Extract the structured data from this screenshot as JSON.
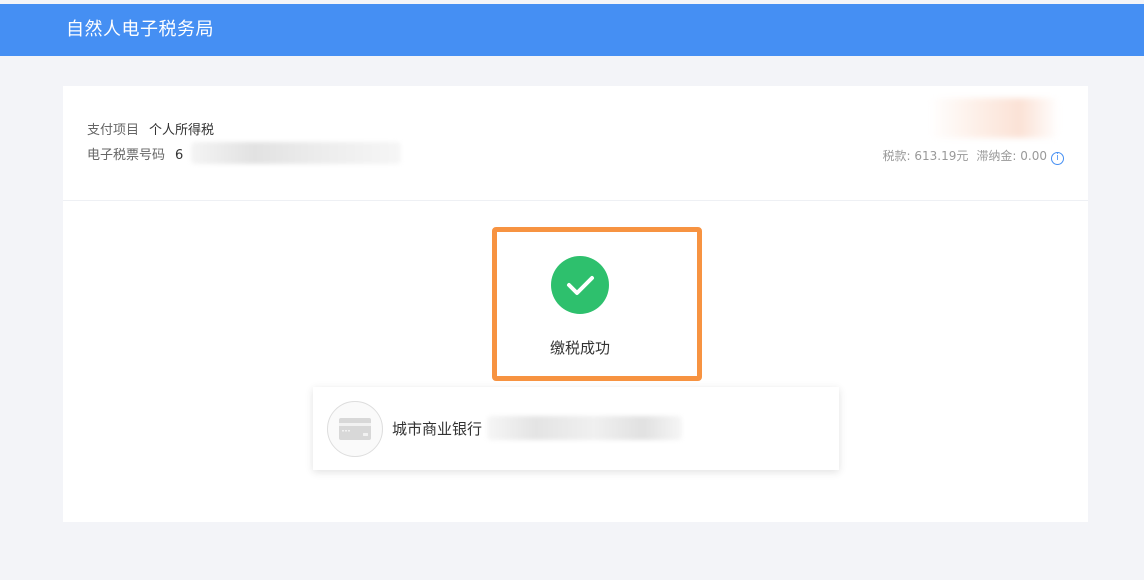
{
  "header": {
    "title": "自然人电子税务局",
    "bg_color": "#458ff3"
  },
  "payment": {
    "item_label": "支付项目",
    "item_value": "个人所得税",
    "ticket_label": "电子税票号码",
    "ticket_value_visible": "6",
    "tax_label": "税款:",
    "tax_value": "613.19元",
    "late_fee_label": "滞纳金:",
    "late_fee_value": "0.00",
    "info_icon": "info-icon"
  },
  "status": {
    "text": "缴税成功",
    "icon": "check-circle-icon",
    "success_color": "#2ec06d",
    "highlight_color": "#f79341"
  },
  "bank": {
    "name_visible": "城市商业银行",
    "icon": "bank-card-icon"
  }
}
